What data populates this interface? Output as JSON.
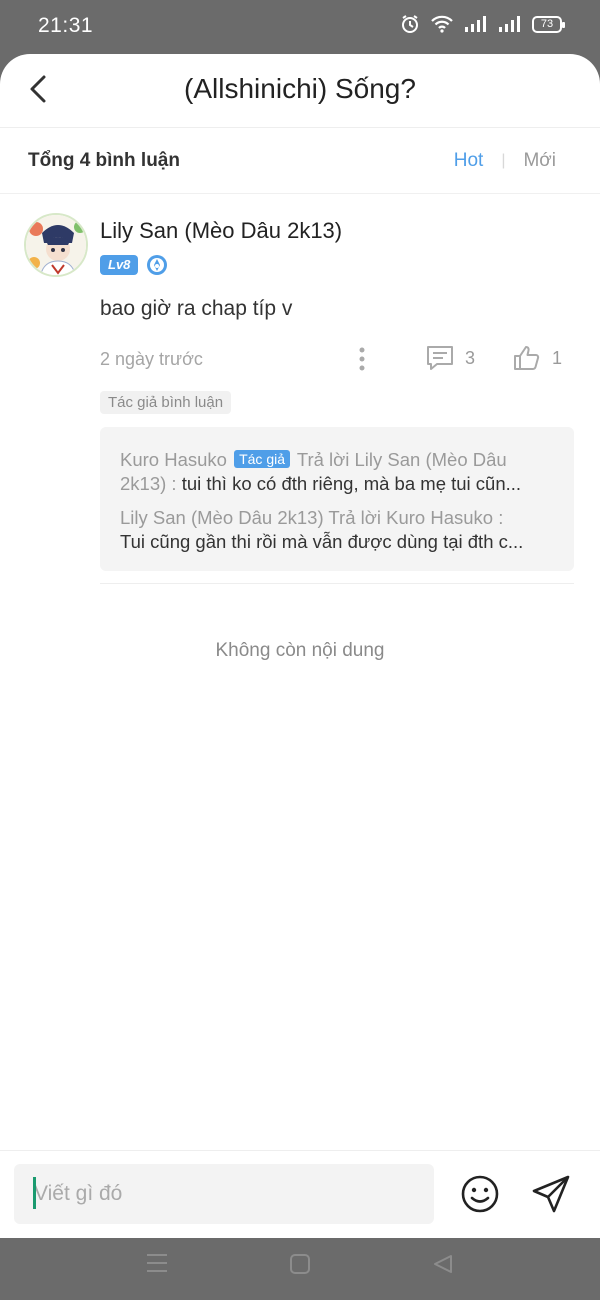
{
  "status_bar": {
    "time": "21:31",
    "battery": "73"
  },
  "header": {
    "title": "(Allshinichi) Sống?",
    "back_icon": "chevron-left-icon"
  },
  "subbar": {
    "total": "Tổng 4 bình luận",
    "sort_hot": "Hot",
    "sort_new": "Mới",
    "sort_active_color": "#4f9ee8"
  },
  "comment": {
    "username": "Lily San (Mèo Dâu 2k13)",
    "level": "Lv8",
    "text": "bao giờ ra chap típ v",
    "time": "2 ngày trước",
    "reply_count": "3",
    "like_count": "1",
    "tag": "Tác giả bình luận",
    "replies": [
      {
        "author": "Kuro Hasuko",
        "author_tag": "Tác giả",
        "reply_to": "Trả lời Lily San (Mèo Dâu 2k13) :",
        "content": "tui thì ko có đth riêng, mà ba mẹ tui cũn..."
      },
      {
        "author": "Lily San (Mèo Dâu 2k13)",
        "reply_to": "Trả lời Kuro Hasuko :",
        "content": "Tui cũng gần thi rồi mà vẫn được dùng tại đth c..."
      }
    ]
  },
  "end_text": "Không còn nội dung",
  "input": {
    "placeholder": "Viết gì đó"
  }
}
